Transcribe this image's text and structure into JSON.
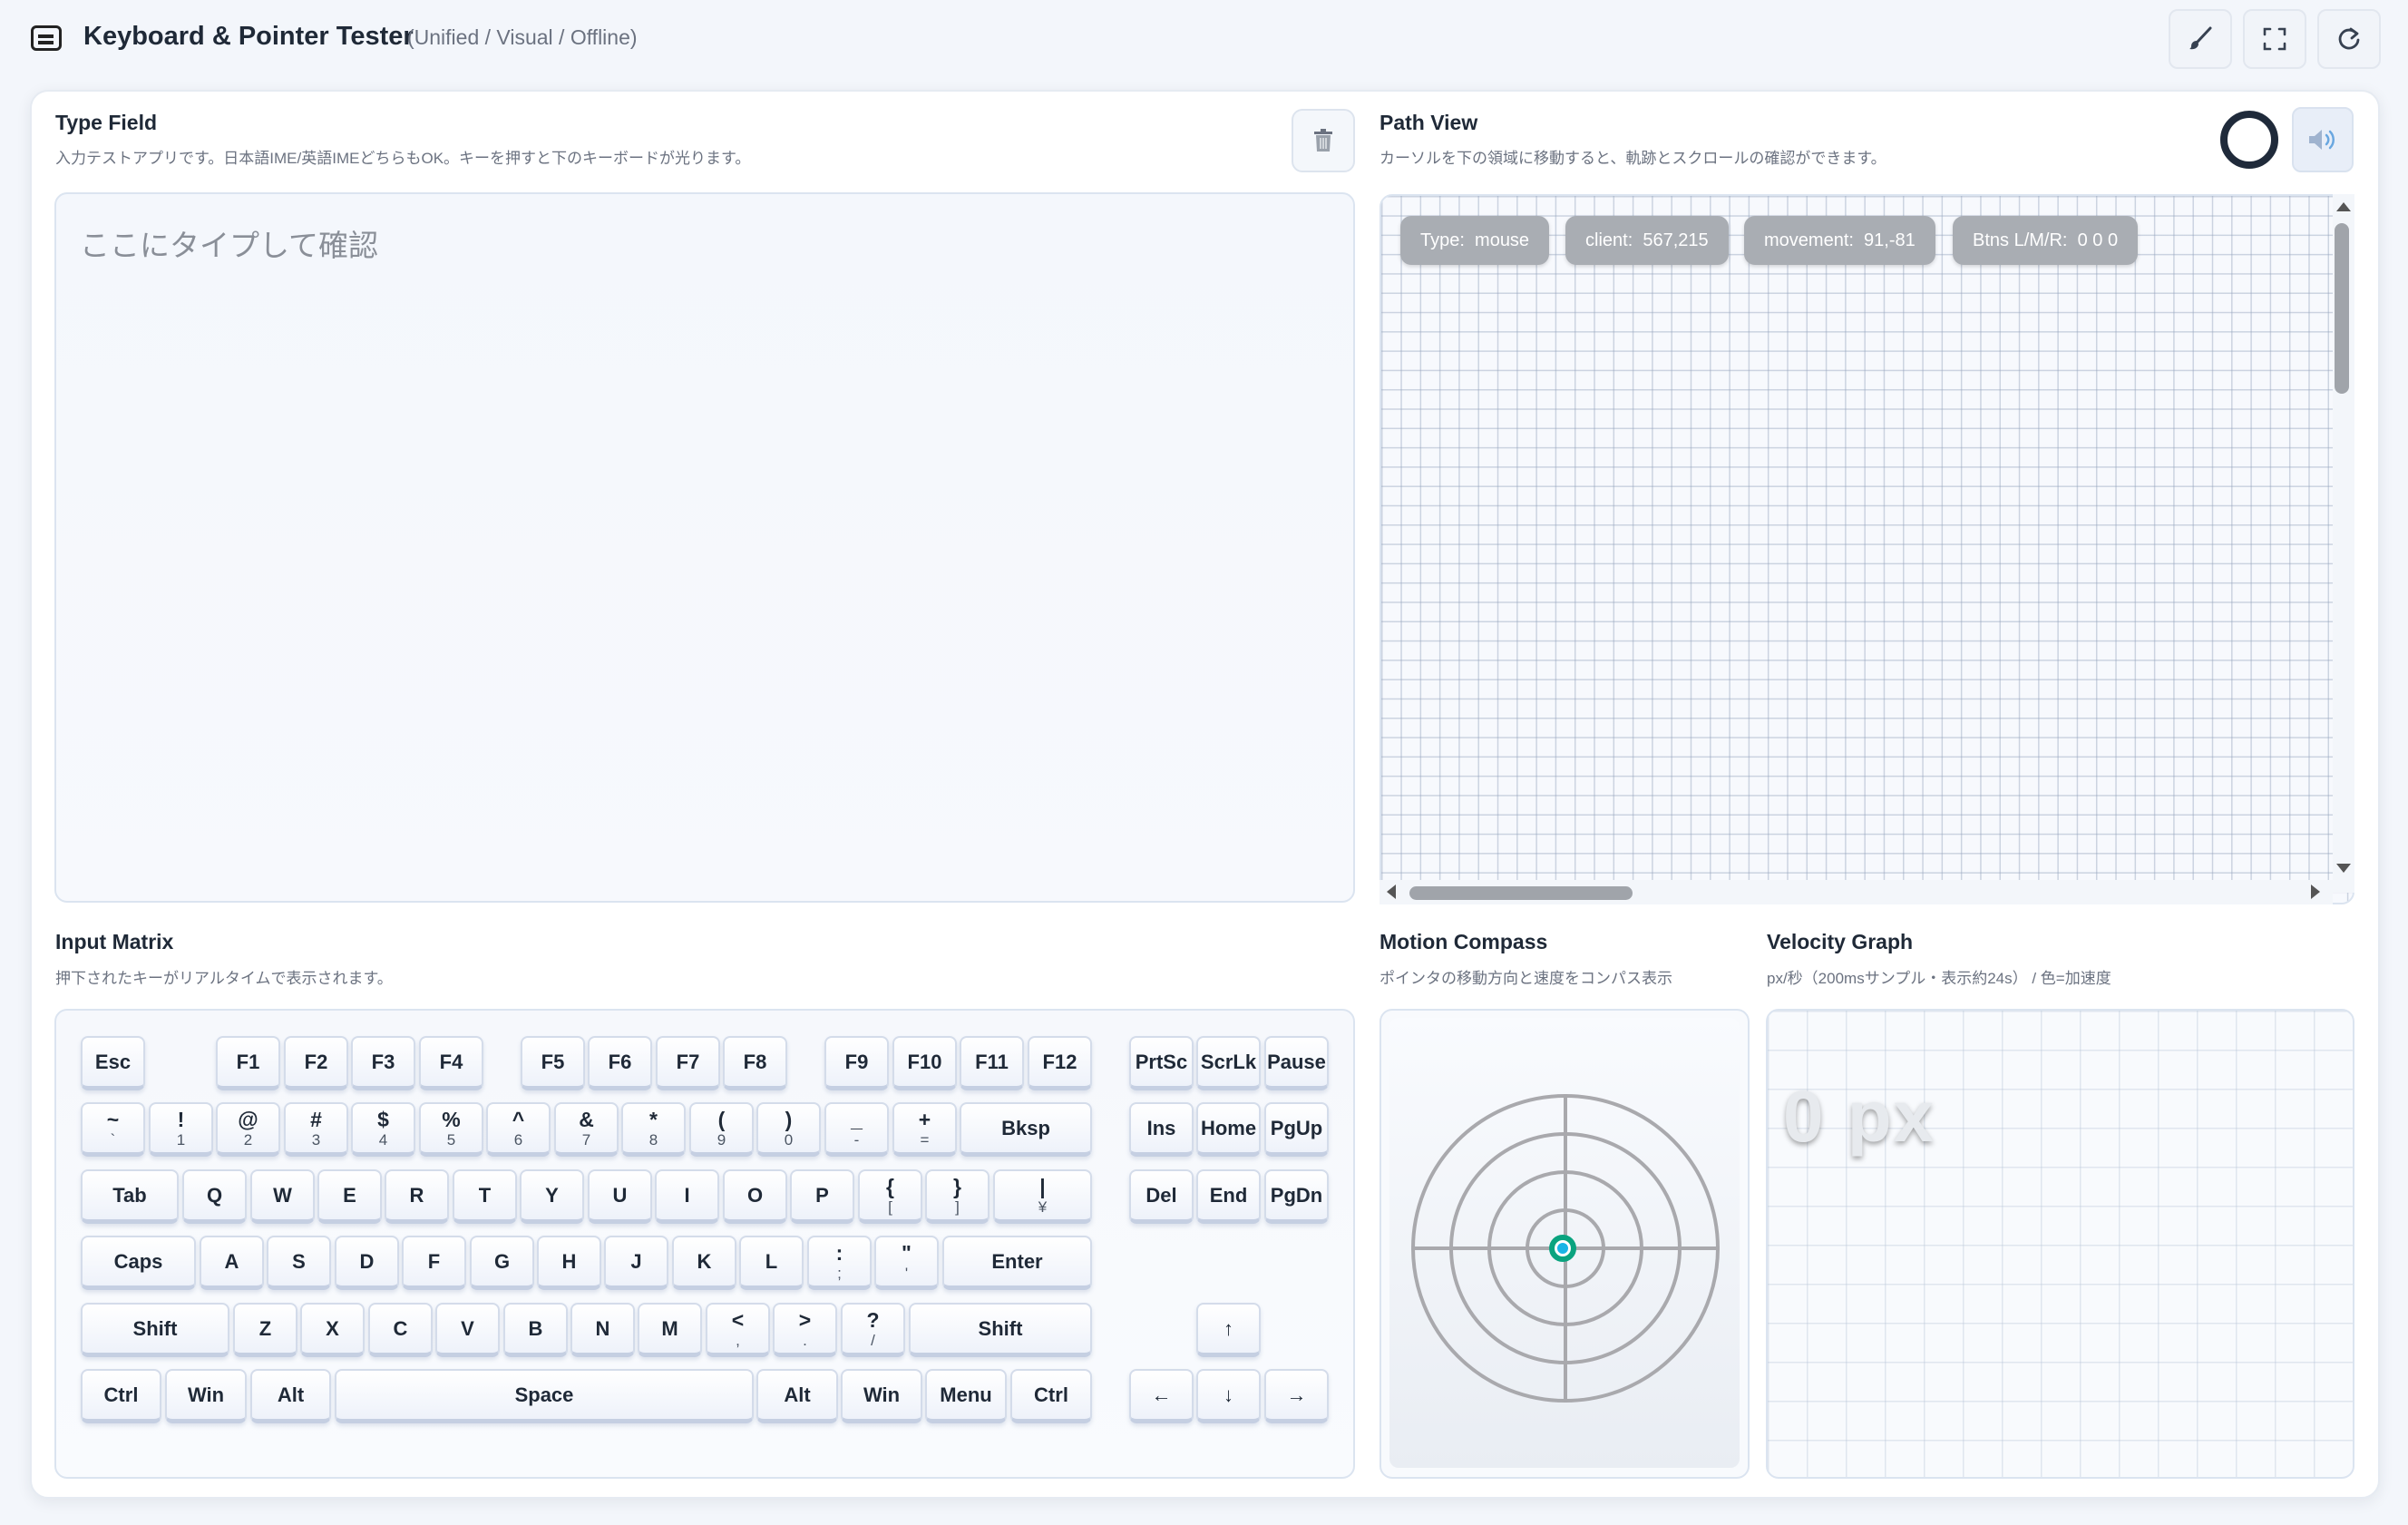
{
  "header": {
    "title": "Keyboard & Pointer Tester",
    "subtitle": "(Unified / Visual / Offline)",
    "buttons": {
      "brush": "brush-icon",
      "fullscreen": "fullscreen-icon",
      "reset": "reset-icon"
    }
  },
  "type_field": {
    "title": "Type Field",
    "desc": "入力テストアプリです。日本語IME/英語IMEどちらもOK。キーを押すと下のキーボードが光ります。",
    "placeholder": "ここにタイプして確認",
    "value": ""
  },
  "path_view": {
    "title": "Path View",
    "desc": "カーソルを下の領域に移動すると、軌跡とスクロールの確認ができます。",
    "chips": {
      "type": "Type:  mouse",
      "client": "client:  567,215",
      "movement": "movement:  91,-81",
      "buttons": "Btns L/M/R:  0 0 0"
    }
  },
  "input_matrix": {
    "title": "Input Matrix",
    "desc": "押下されたキーがリアルタイムで表示されます。"
  },
  "keys": {
    "esc": "Esc",
    "f1": "F1",
    "f2": "F2",
    "f3": "F3",
    "f4": "F4",
    "f5": "F5",
    "f6": "F6",
    "f7": "F7",
    "f8": "F8",
    "f9": "F9",
    "f10": "F10",
    "f11": "F11",
    "f12": "F12",
    "prtsc": "PrtSc",
    "scrlk": "ScrLk",
    "pause": "Pause",
    "tilde": {
      "top": "~",
      "bot": "`"
    },
    "d1": {
      "top": "!",
      "bot": "1"
    },
    "d2": {
      "top": "@",
      "bot": "2"
    },
    "d3": {
      "top": "#",
      "bot": "3"
    },
    "d4": {
      "top": "$",
      "bot": "4"
    },
    "d5": {
      "top": "%",
      "bot": "5"
    },
    "d6": {
      "top": "^",
      "bot": "6"
    },
    "d7": {
      "top": "&",
      "bot": "7"
    },
    "d8": {
      "top": "*",
      "bot": "8"
    },
    "d9": {
      "top": "(",
      "bot": "9"
    },
    "d0": {
      "top": ")",
      "bot": "0"
    },
    "minus": {
      "top": "_",
      "bot": "-"
    },
    "equal": {
      "top": "+",
      "bot": "="
    },
    "bksp": "Bksp",
    "ins": "Ins",
    "home": "Home",
    "pgup": "PgUp",
    "tab": "Tab",
    "q": "Q",
    "w": "W",
    "e": "E",
    "r": "R",
    "t": "T",
    "y": "Y",
    "u": "U",
    "i": "I",
    "o": "O",
    "p": "P",
    "lbracket": {
      "top": "{",
      "bot": "["
    },
    "rbracket": {
      "top": "}",
      "bot": "]"
    },
    "backslash": {
      "top": "|",
      "bot": "¥"
    },
    "del": "Del",
    "end": "End",
    "pgdn": "PgDn",
    "caps": "Caps",
    "a": "A",
    "s": "S",
    "d": "D",
    "f": "F",
    "g": "G",
    "h": "H",
    "j": "J",
    "k": "K",
    "l": "L",
    "semicolon": {
      "top": ":",
      "bot": ";"
    },
    "quote": {
      "top": "\"",
      "bot": "'"
    },
    "enter": "Enter",
    "lshift": "Shift",
    "z": "Z",
    "x": "X",
    "c": "C",
    "v": "V",
    "b": "B",
    "n": "N",
    "m": "M",
    "comma": {
      "top": "<",
      "bot": ","
    },
    "period": {
      "top": ">",
      "bot": "."
    },
    "slash": {
      "top": "?",
      "bot": "/"
    },
    "rshift": "Shift",
    "up": "↑",
    "lctrl": "Ctrl",
    "lwin": "Win",
    "lalt": "Alt",
    "space": "Space",
    "ralt": "Alt",
    "rwin": "Win",
    "menu": "Menu",
    "rctrl": "Ctrl",
    "left": "←",
    "down": "↓",
    "right": "→"
  },
  "motion_compass": {
    "title": "Motion Compass",
    "desc": "ポインタの移動方向と速度をコンパス表示"
  },
  "velocity_graph": {
    "title": "Velocity Graph",
    "desc": "px/秒（200msサンプル・表示約24s） / 色=加速度",
    "value": "0 px"
  },
  "colors": {
    "accent": "#1f2a3a",
    "compass_dot": "#19b4e6",
    "compass_ring": "#0aa37f"
  }
}
